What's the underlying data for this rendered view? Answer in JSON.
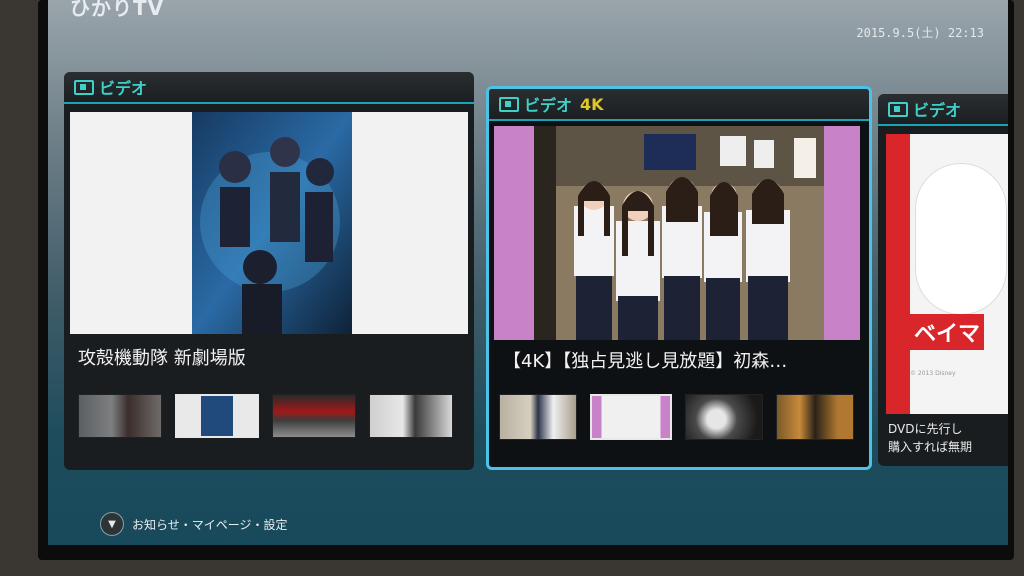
{
  "header": {
    "brand": "ひかりTV",
    "datetime": "2015.9.5(土) 22:13"
  },
  "cards": [
    {
      "category": "ビデオ",
      "badge": "",
      "title": "攻殻機動隊 新劇場版",
      "thumbnails": [
        "thumb-1",
        "thumb-2",
        "thumb-3",
        "thumb-4"
      ]
    },
    {
      "category": "ビデオ",
      "badge": "4K",
      "title": "【4K】【独占見逃し見放題】初森…",
      "thumbnails": [
        "thumb-1",
        "thumb-2",
        "thumb-3",
        "thumb-4"
      ]
    },
    {
      "category": "ビデオ",
      "badge": "",
      "title": "",
      "poster_text": "ベイマ",
      "promo_line1": "DVDに先行し",
      "promo_line2": "購入すれば無期",
      "copyright": "© 2013 Disney"
    }
  ],
  "bottom": {
    "button_icon": "down-triangle-icon",
    "label": "お知らせ・マイページ・設定"
  },
  "colors": {
    "accent": "#4cc3e6",
    "category_text": "#3fd0c8",
    "badge_4k": "#e0c62b"
  }
}
